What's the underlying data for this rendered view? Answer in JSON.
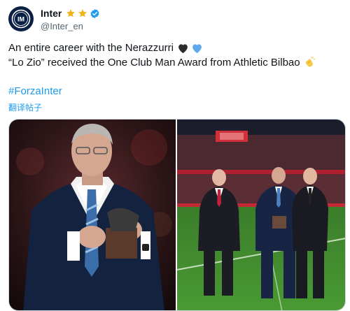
{
  "account": {
    "display_name": "Inter",
    "handle": "@Inter_en",
    "avatar_icon": "inter-logo",
    "badges": [
      "star-icon",
      "star-icon",
      "verified-icon"
    ],
    "verified_color": "#1d9bf0"
  },
  "post": {
    "line1": "An entire career with the Nerazzurri",
    "line1_emojis": [
      "black-heart-icon",
      "blue-heart-icon"
    ],
    "line2": "“Lo Zio” received the One Club Man Award from Athletic Bilbao",
    "line2_emoji": "clapping-hands-icon",
    "hashtag": "#ForzaInter",
    "translate_link": "翻译帖子"
  },
  "media": {
    "count": 2,
    "photo1": "man-holding-award-photo",
    "photo2": "three-men-on-pitch-photo"
  },
  "colors": {
    "link": "#1d9bf0",
    "secondary_text": "#536471",
    "pitch_green": "#3f8a2e"
  }
}
